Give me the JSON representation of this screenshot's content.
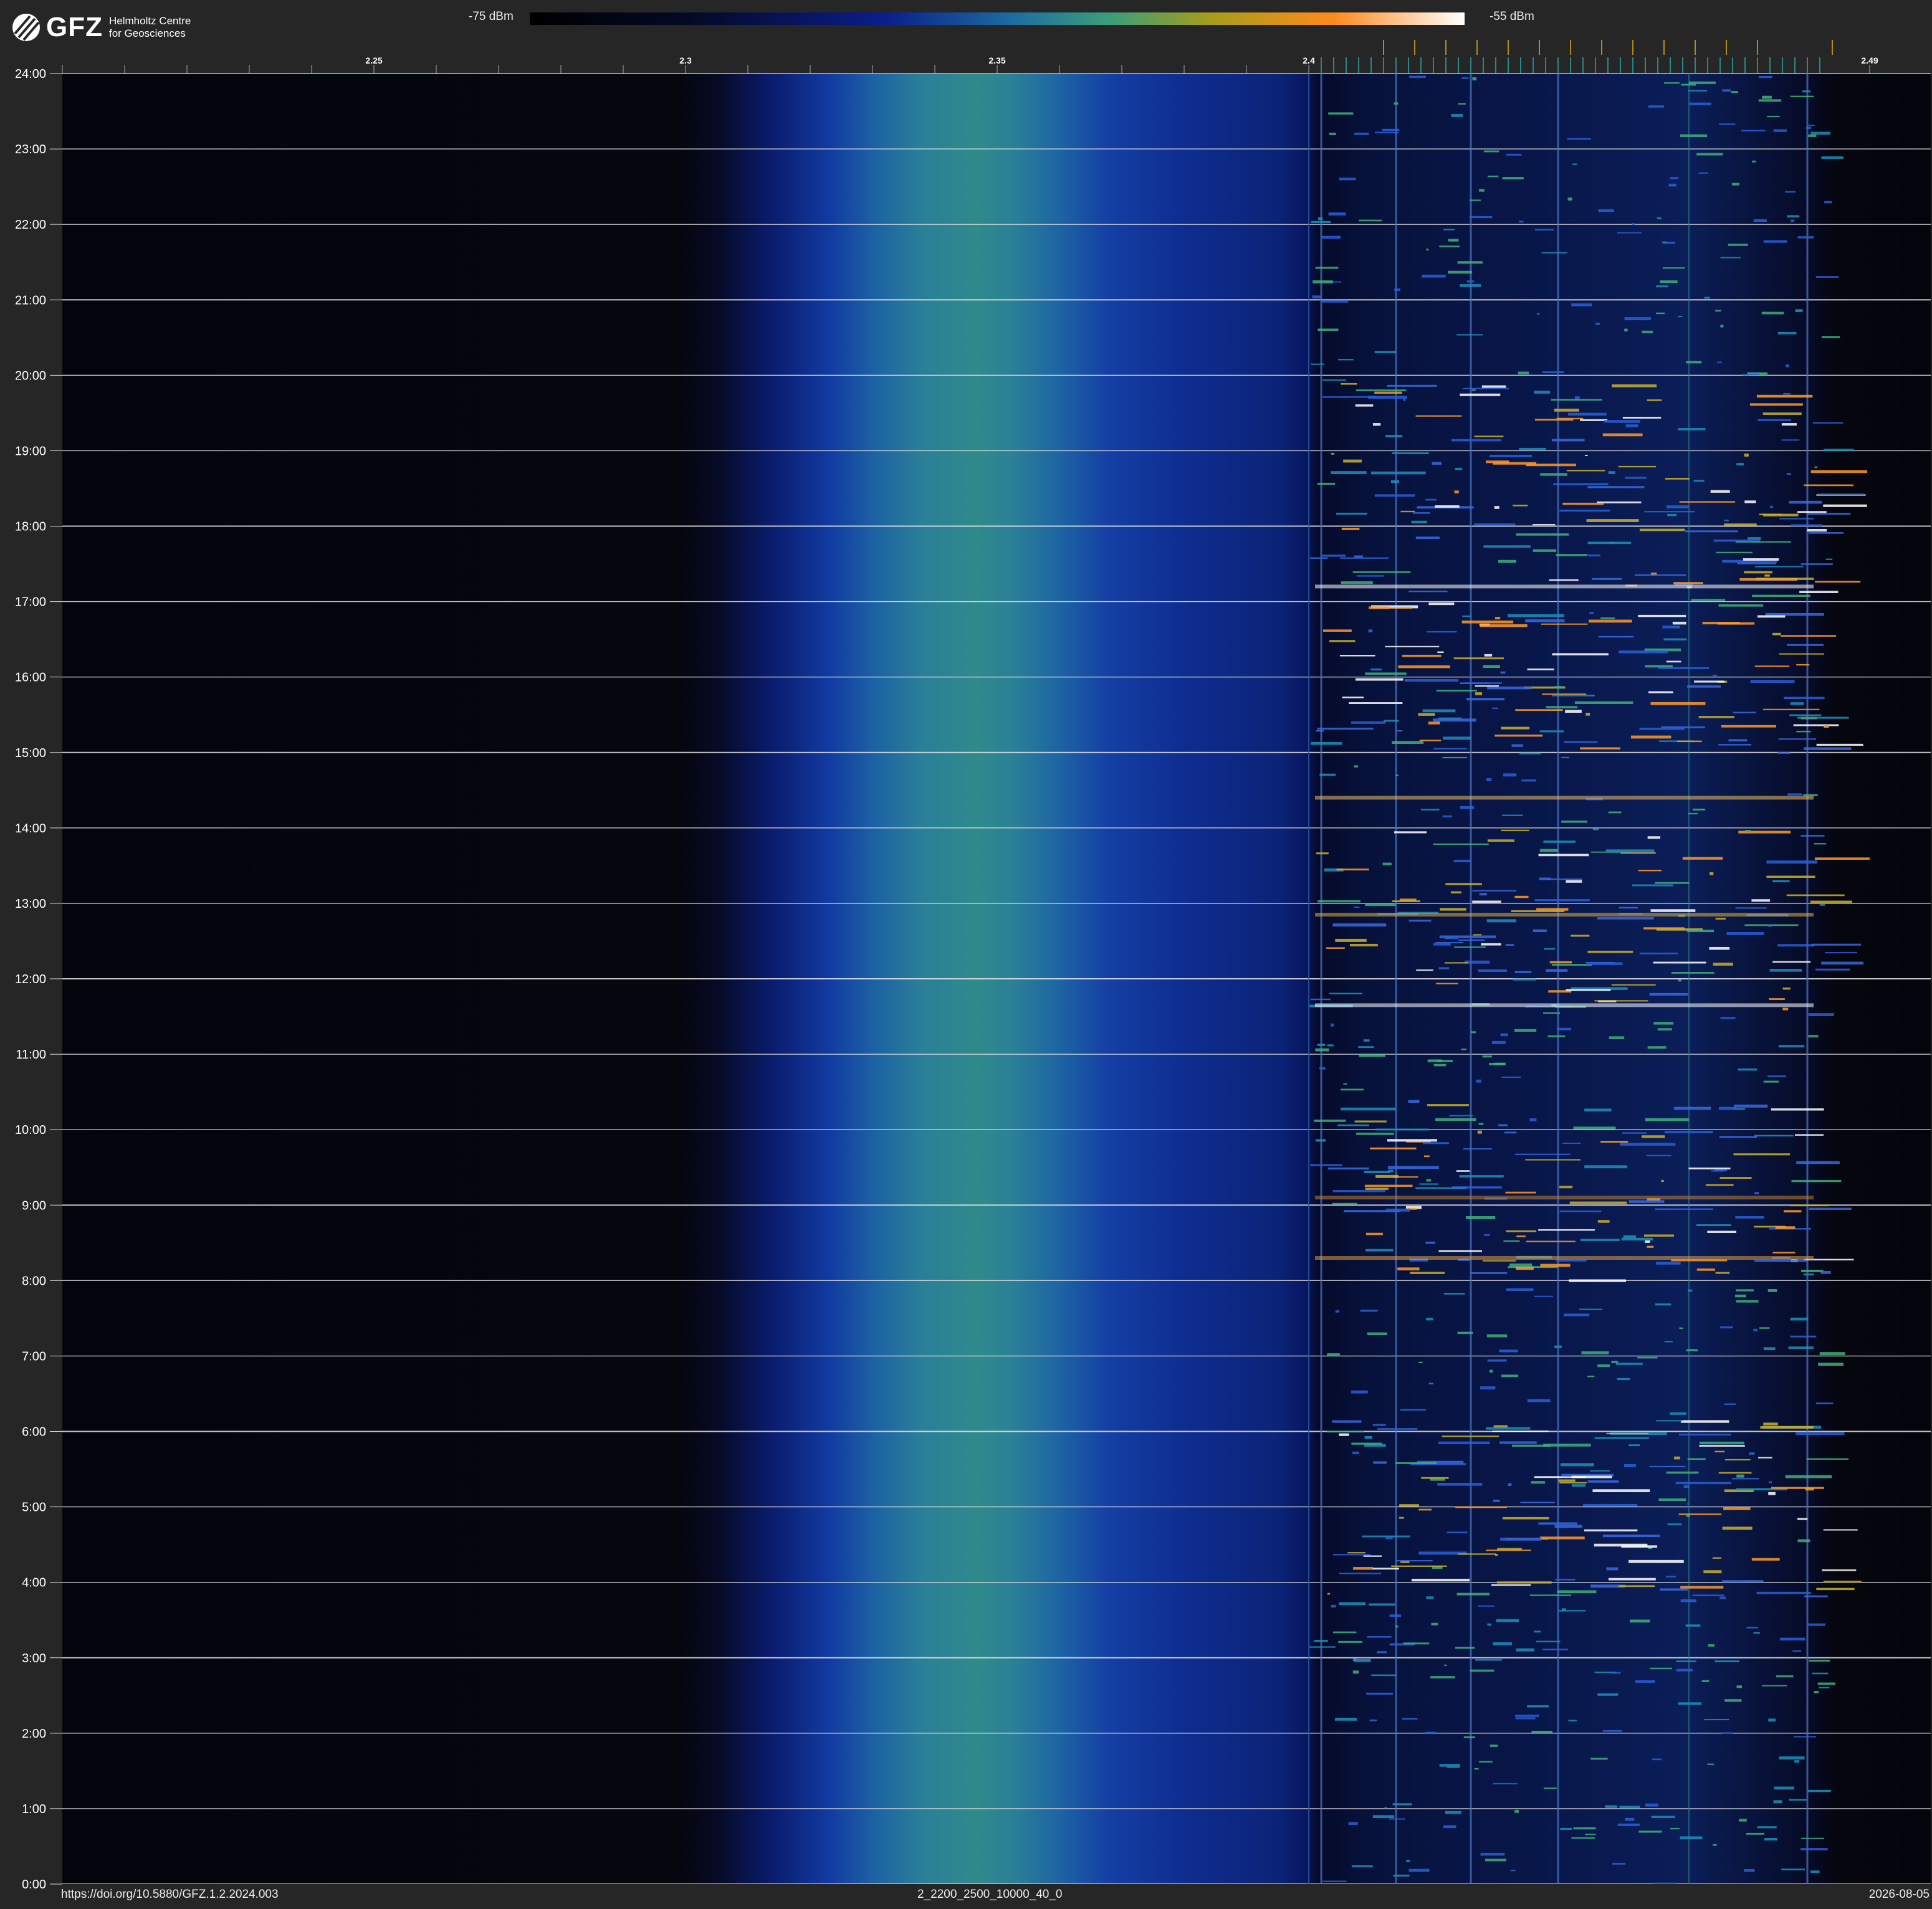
{
  "header": {
    "logo_text": "GFZ",
    "logo_subtitle_line1": "Helmholtz Centre",
    "logo_subtitle_line2": "for Geosciences",
    "colorbar_min_label": "-75 dBm",
    "colorbar_max_label": "-55 dBm"
  },
  "footer": {
    "doi": "https://doi.org/10.5880/GFZ.1.2.2024.003",
    "dataset_id": "2_2200_2500_10000_40_0",
    "date": "2026-08-05"
  },
  "colors": {
    "background": "#262626",
    "gridline": "#ffffff",
    "marker_yellow": "#d8b020",
    "marker_cyan": "#2aa8a8"
  },
  "chart_data": {
    "type": "heatmap",
    "title": "",
    "x_axis": {
      "unit_shown": "",
      "range": [
        2.2,
        2.5
      ],
      "tick_labels": [
        "2.25",
        "2.3",
        "2.35",
        "2.4",
        "2.49"
      ],
      "tick_values": [
        2.25,
        2.3,
        2.35,
        2.4,
        2.49
      ],
      "minor_tick_step": 0.01
    },
    "y_axis": {
      "range_hours": [
        0,
        24
      ],
      "tick_labels": [
        "0:00",
        "1:00",
        "2:00",
        "3:00",
        "4:00",
        "5:00",
        "6:00",
        "7:00",
        "8:00",
        "9:00",
        "10:00",
        "11:00",
        "12:00",
        "13:00",
        "14:00",
        "15:00",
        "16:00",
        "17:00",
        "18:00",
        "19:00",
        "20:00",
        "21:00",
        "22:00",
        "23:00",
        "24:00"
      ],
      "gridlines": true
    },
    "color_scale": {
      "min_dbm": -75,
      "max_dbm": -55,
      "colormap": "black-blue-teal-orange-white"
    },
    "features": {
      "broadband_noise_hump": {
        "from_freq": 2.305,
        "to_freq": 2.4,
        "peak_freq": 2.34
      },
      "wifi_activity_band": {
        "from_freq": 2.4,
        "to_freq": 2.483
      },
      "continuous_lines_freq": [
        2.402,
        2.414,
        2.426,
        2.44,
        2.48
      ],
      "intermittent_line_freq": 2.461,
      "strong_activity_hours": [
        5,
        9.2,
        12.8,
        16.2,
        17.2,
        18.7
      ],
      "ism_channel_markers_yellow": [
        2.412,
        2.417,
        2.422,
        2.427,
        2.432,
        2.437,
        2.442,
        2.447,
        2.452,
        2.457,
        2.462,
        2.467,
        2.472,
        2.484
      ],
      "ism_channel_markers_cyan_step": 0.002
    }
  }
}
